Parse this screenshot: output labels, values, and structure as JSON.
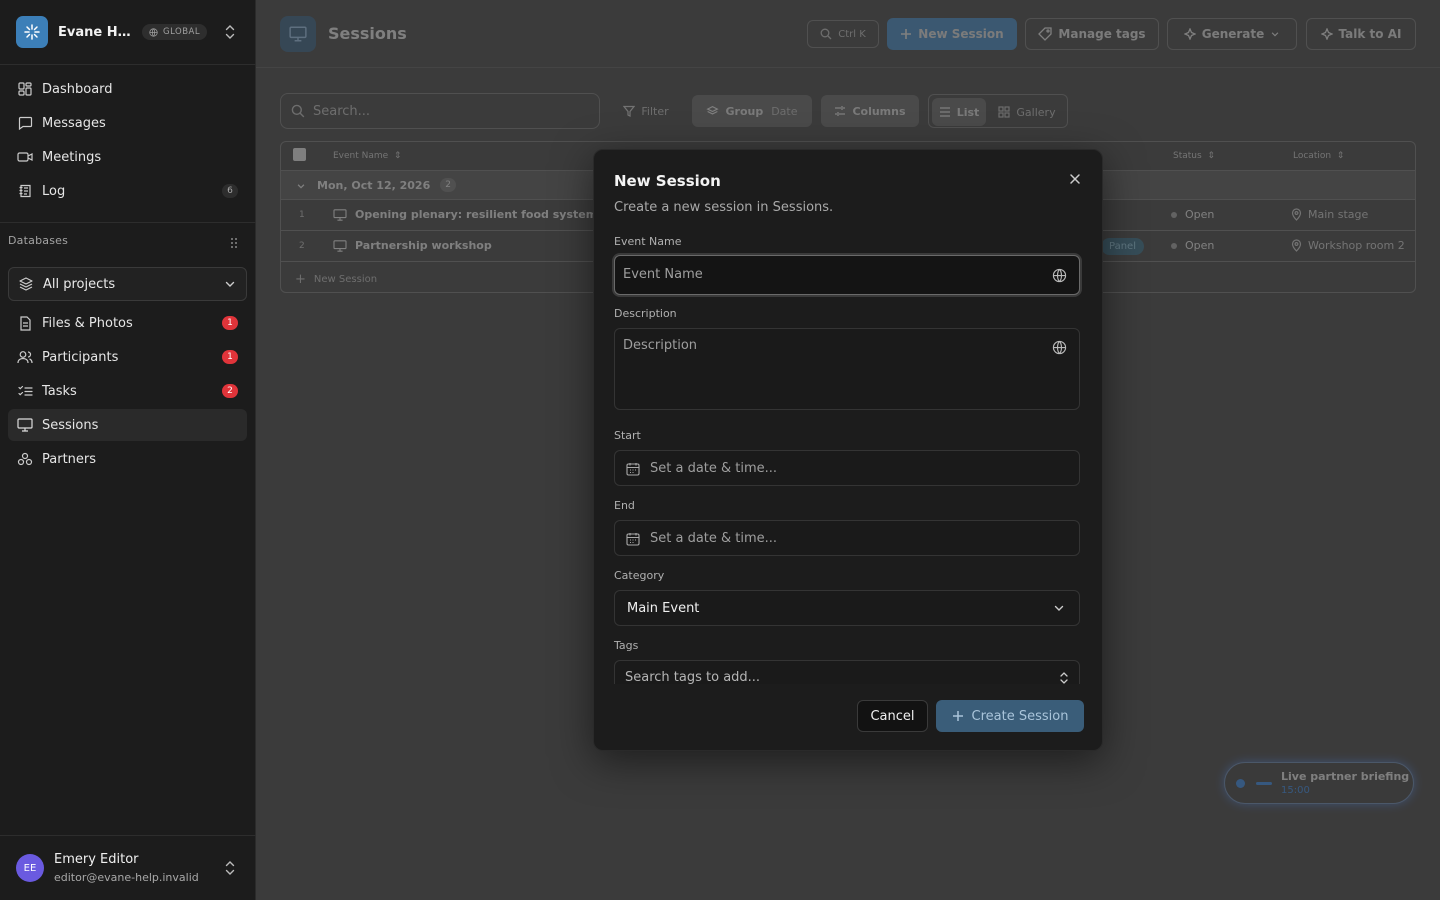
{
  "workspace": {
    "name": "Evane He...",
    "badge": "GLOBAL"
  },
  "nav": {
    "main": [
      {
        "label": "Dashboard",
        "icon": "dashboard-icon"
      },
      {
        "label": "Messages",
        "icon": "message-icon"
      },
      {
        "label": "Meetings",
        "icon": "video-icon"
      },
      {
        "label": "Log",
        "icon": "log-icon",
        "count": "6"
      }
    ],
    "databases_label": "Databases",
    "project_selector": "All projects",
    "db_items": [
      {
        "label": "Files & Photos",
        "badge": "1"
      },
      {
        "label": "Participants",
        "badge": "1"
      },
      {
        "label": "Tasks",
        "badge": "2"
      },
      {
        "label": "Sessions"
      },
      {
        "label": "Partners"
      }
    ]
  },
  "user": {
    "initials": "EE",
    "name": "Emery Editor",
    "email": "editor@evane-help.invalid"
  },
  "page": {
    "title": "Sessions",
    "shortcut": "Ctrl K",
    "new_session": "New Session",
    "manage_tags": "Manage tags",
    "generate": "Generate",
    "talk_to_ai": "Talk to AI"
  },
  "toolbar": {
    "search_placeholder": "Search...",
    "filter": "Filter",
    "group": "Group",
    "group_by": "Date",
    "columns": "Columns",
    "list": "List",
    "gallery": "Gallery"
  },
  "table": {
    "headers": {
      "name": "Event Name",
      "status": "Status",
      "location": "Location"
    },
    "group": {
      "label": "Mon, Oct 12, 2026",
      "count": "2"
    },
    "rows": [
      {
        "n": "1",
        "name": "Opening plenary: resilient food systems",
        "status": "Open",
        "location": "Main stage"
      },
      {
        "n": "2",
        "name": "Partnership workshop",
        "tag": "Panel",
        "status": "Open",
        "location": "Workshop room 2"
      }
    ],
    "new_row": "New Session"
  },
  "toast": {
    "title": "Live partner briefing",
    "time": "15:00"
  },
  "modal": {
    "title": "New Session",
    "subtitle": "Create a new session in Sessions.",
    "event_name": {
      "label": "Event Name",
      "placeholder": "Event Name"
    },
    "description": {
      "label": "Description",
      "placeholder": "Description"
    },
    "start": {
      "label": "Start",
      "placeholder": "Set a date & time..."
    },
    "end": {
      "label": "End",
      "placeholder": "Set a date & time..."
    },
    "category": {
      "label": "Category",
      "value": "Main Event"
    },
    "tags": {
      "label": "Tags",
      "placeholder": "Search tags to add..."
    },
    "cancel": "Cancel",
    "create": "Create Session"
  }
}
